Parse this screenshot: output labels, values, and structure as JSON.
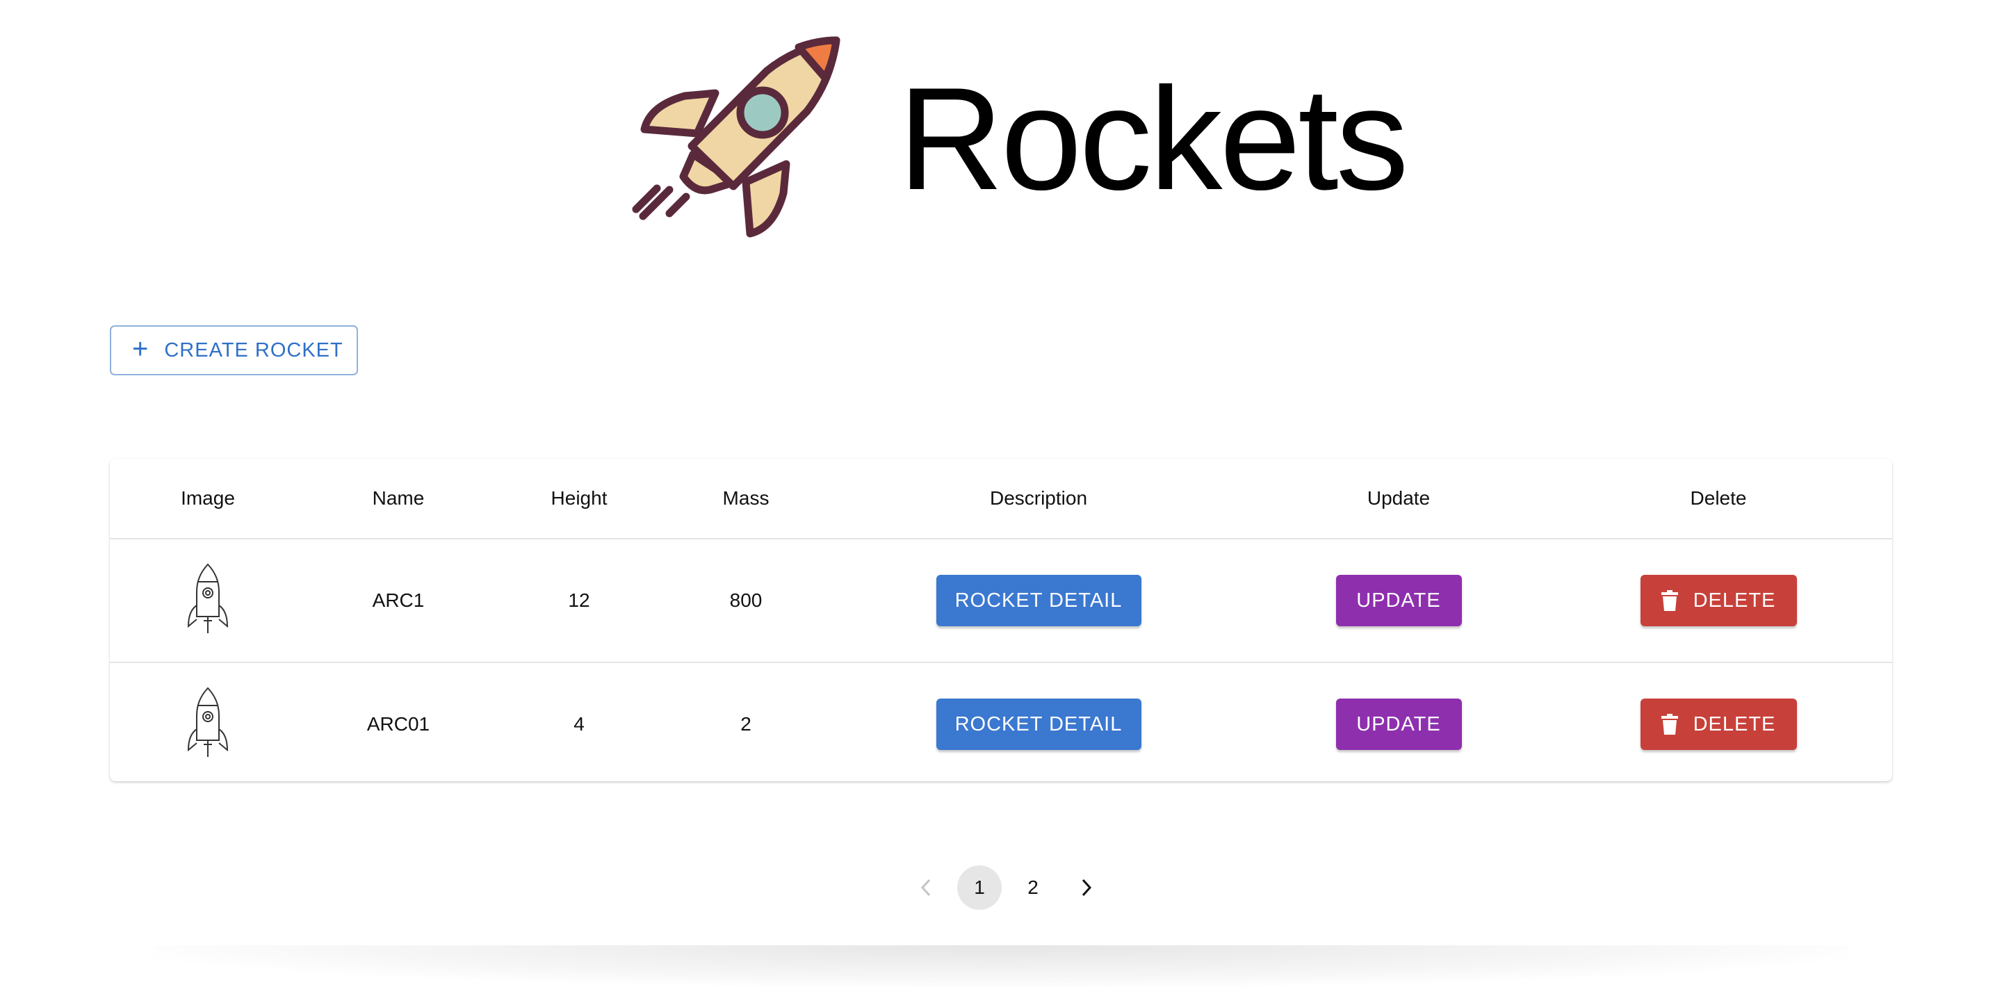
{
  "header": {
    "title": "Rockets",
    "logo_icon": "rocket-logo-icon"
  },
  "actions": {
    "create_label": "CREATE ROCKET",
    "create_icon": "plus-icon"
  },
  "table": {
    "columns": [
      "Image",
      "Name",
      "Height",
      "Mass",
      "Description",
      "Update",
      "Delete"
    ],
    "rows": [
      {
        "image_icon": "rocket-outline-icon",
        "name": "ARC1",
        "height": "12",
        "mass": "800",
        "detail_label": "ROCKET DETAIL",
        "update_label": "UPDATE",
        "delete_label": "DELETE"
      },
      {
        "image_icon": "rocket-outline-icon",
        "name": "ARC01",
        "height": "4",
        "mass": "2",
        "detail_label": "ROCKET DETAIL",
        "update_label": "UPDATE",
        "delete_label": "DELETE"
      }
    ]
  },
  "pagination": {
    "prev_icon": "chevron-left-icon",
    "pages": [
      "1",
      "2"
    ],
    "current": "1",
    "next_icon": "chevron-right-icon"
  },
  "colors": {
    "primary": "#3b78d0",
    "update": "#8e2fae",
    "delete": "#c8403a",
    "logo_outline": "#5a2a3c",
    "logo_body": "#f0d6a4",
    "logo_nose": "#ef7d43",
    "logo_window": "#9ccac3"
  }
}
